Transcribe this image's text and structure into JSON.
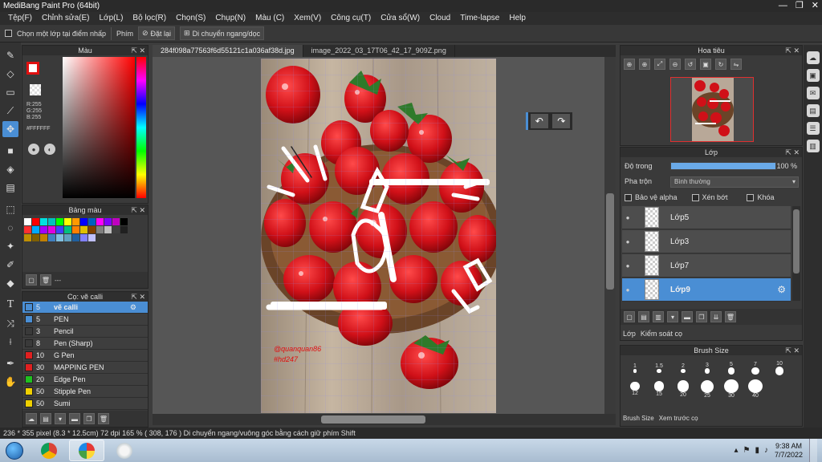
{
  "window": {
    "title": "MediBang Paint Pro (64bit)",
    "controls": [
      "—",
      "❐",
      "✕"
    ]
  },
  "menu": [
    "Tệp(F)",
    "Chỉnh sửa(E)",
    "Lớp(L)",
    "Bộ lọc(R)",
    "Chọn(S)",
    "Chụp(N)",
    "Màu (C)",
    "Xem(V)",
    "Công cụ(T)",
    "Cửa sổ(W)",
    "Cloud",
    "Time-lapse",
    "Help"
  ],
  "toolbar": {
    "select_layer_label": "Chọn một lớp tại điểm nhấp",
    "key_label": "Phím",
    "reset_label": "Đặt lại",
    "move_label": "Di chuyển ngang/dọc"
  },
  "color_panel": {
    "title": "Màu",
    "r": "R:255",
    "g": "G:255",
    "b": "B:255",
    "hex": "#FFFFFF",
    "foreground": "#e01010"
  },
  "palette_panel": {
    "title": "Bảng màu",
    "footer_text": "---",
    "swatches": [
      "#ffffff",
      "#ff0000",
      "#00e0e0",
      "#00c0c0",
      "#00ff00",
      "#ffff00",
      "#ff9900",
      "#0000ff",
      "#0060c0",
      "#ff00ff",
      "#8000ff",
      "#c000c0",
      "#000000",
      "#ff3030",
      "#00aaff",
      "#a000ff",
      "#e000e0",
      "#4040ff",
      "#00c080",
      "#ff8000",
      "#e0c000",
      "#804000",
      "#808080",
      "#c0c0c0",
      "#404040",
      "#202020",
      "#c09000",
      "#806000",
      "#c08000",
      "#4080c0",
      "#80c0e0",
      "#60a0c0",
      "#2060a0",
      "#8080ff",
      "#c0c0ff"
    ]
  },
  "brush_panel": {
    "title": "Cọ: vẽ calli",
    "items": [
      {
        "size": "5",
        "name": "vẽ calli",
        "color": "#4a8ed4",
        "active": true
      },
      {
        "size": "5",
        "name": "PEN",
        "color": "#4a8ed4"
      },
      {
        "size": "3",
        "name": "Pencil",
        "color": "#3a3a3a"
      },
      {
        "size": "8",
        "name": "Pen (Sharp)",
        "color": "#3a3a3a"
      },
      {
        "size": "10",
        "name": "G Pen",
        "color": "#e02020"
      },
      {
        "size": "30",
        "name": "MAPPING PEN",
        "color": "#e02020"
      },
      {
        "size": "20",
        "name": "Edge Pen",
        "color": "#20c020"
      },
      {
        "size": "50",
        "name": "Stipple Pen",
        "color": "#f0d000"
      },
      {
        "size": "50",
        "name": "Sumi",
        "color": "#f0d000"
      }
    ]
  },
  "canvas": {
    "tabs": [
      "284f098a77563f6d55121c1a036af38d.jpg",
      "image_2022_03_17T06_42_17_909Z.png"
    ],
    "watermark_1": "@quanquan86",
    "watermark_2": "#hd247"
  },
  "navigator": {
    "title": "Hoa tiêu"
  },
  "layer_panel": {
    "title": "Lớp",
    "opacity_label": "Độ trong",
    "opacity_value": "100 %",
    "opacity": 1.0,
    "blend_label": "Pha trộn",
    "blend_value": "Bình thường",
    "protect_alpha": "Bảo vệ alpha",
    "clip": "Xén bớt",
    "lock": "Khóa",
    "layers": [
      "Lớp5",
      "Lớp3",
      "Lớp7",
      "Lớp9"
    ],
    "tab_layer": "Lớp",
    "tab_check": "Kiểm soát cọ"
  },
  "brush_size_panel": {
    "title": "Brush Size",
    "sizes": [
      "1",
      "1.5",
      "2",
      "3",
      "5",
      "7",
      "10",
      "12",
      "15",
      "20",
      "25",
      "30",
      "40"
    ],
    "tab_size": "Brush Size",
    "tab_preview": "Xem trước cọ"
  },
  "status": {
    "text": "236 * 355 pixel   (8.3 * 12.5cm)   72 dpi   165 %   ( 308, 176 )   Di chuyển ngang/vuông góc bằng cách giữ phím Shift"
  },
  "taskbar": {
    "time": "9:38 AM",
    "date": "7/7/2022"
  }
}
